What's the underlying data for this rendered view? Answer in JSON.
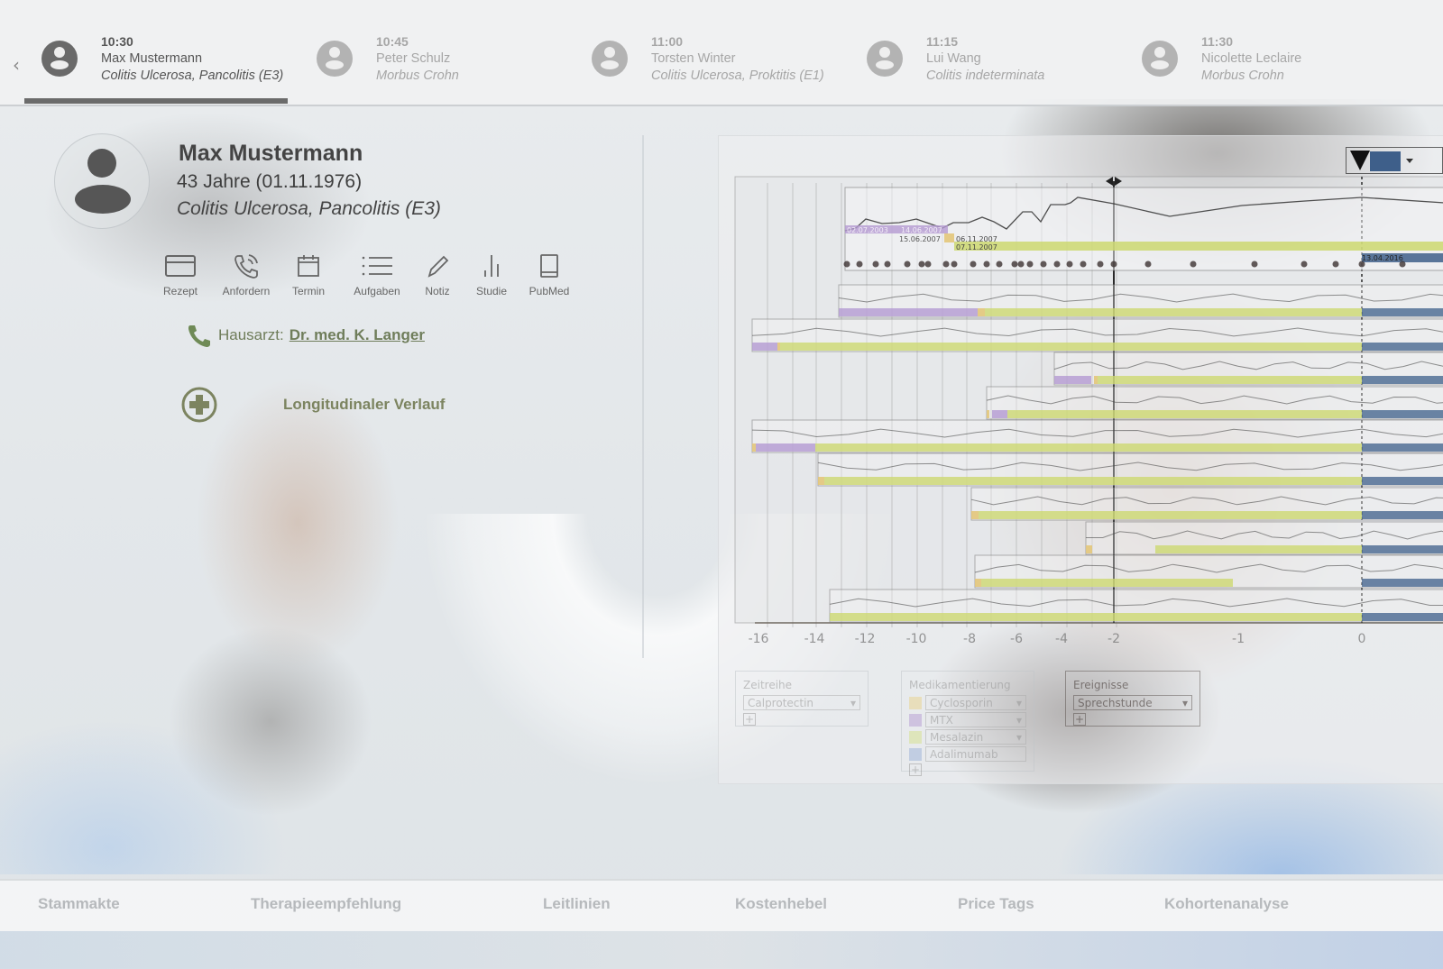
{
  "schedule": {
    "prev_icon": "chevron-left-icon",
    "appointments": [
      {
        "time": "10:30",
        "name": "Max Mustermann",
        "diagnosis": "Colitis Ulcerosa, Pancolitis (E3)",
        "active": true
      },
      {
        "time": "10:45",
        "name": "Peter Schulz",
        "diagnosis": "Morbus Crohn",
        "active": false
      },
      {
        "time": "11:00",
        "name": "Torsten Winter",
        "diagnosis": "Colitis Ulcerosa, Proktitis (E1)",
        "active": false
      },
      {
        "time": "11:15",
        "name": "Lui Wang",
        "diagnosis": "Colitis indeterminata",
        "active": false
      },
      {
        "time": "11:30",
        "name": "Nicolette Leclaire",
        "diagnosis": "Morbus Crohn",
        "active": false
      }
    ]
  },
  "patient": {
    "name": "Max Mustermann",
    "age": "43 Jahre (01.11.1976)",
    "diagnosis": "Colitis Ulcerosa, Pancolitis (E3)",
    "actions": [
      {
        "label": "Rezept",
        "icon": "credit-card-icon"
      },
      {
        "label": "Anfordern",
        "icon": "phone-ringing-icon"
      },
      {
        "label": "Termin",
        "icon": "calendar-icon"
      },
      {
        "label": "Aufgaben",
        "icon": "list-icon"
      },
      {
        "label": "Notiz",
        "icon": "pencil-icon"
      },
      {
        "label": "Studie",
        "icon": "bar-chart-icon"
      },
      {
        "label": "PubMed",
        "icon": "book-icon"
      }
    ],
    "gp_label": "Hausarzt:",
    "gp_name": "Dr. med. K. Langer",
    "longitudinal_label": "Longitudinaler Verlauf"
  },
  "chart": {
    "x_ticks": [
      "-16",
      "-14",
      "-12",
      "-10",
      "-8",
      "-6",
      "-4",
      "-2",
      "-1",
      "0"
    ],
    "date_labels": [
      "02.07.2003",
      "14.06.2007",
      "15.06.2007",
      "06.11.2007",
      "07.11.2007",
      "13.04.2016"
    ],
    "legend": {
      "timeseries": {
        "title": "Zeitreihe",
        "selected": "Calprotectin"
      },
      "medication": {
        "title": "Medikamentierung",
        "items": [
          {
            "label": "Cyclosporin",
            "color": "#e8d28a"
          },
          {
            "label": "MTX",
            "color": "#b49ad2"
          },
          {
            "label": "Mesalazin",
            "color": "#d4e08a"
          },
          {
            "label": "Adalimumab",
            "color": "#9ab0d8"
          }
        ]
      },
      "events": {
        "title": "Ereignisse",
        "selected": "Sprechstunde"
      }
    },
    "colors": {
      "mtx": "#b49ad2",
      "cyclosporin": "#e3c77a",
      "mesalazin": "#cdd870",
      "adalimumab": "#3e5f8a"
    }
  },
  "bottom_nav": {
    "items": [
      "Stammakte",
      "Therapieempfehlung",
      "Leitlinien",
      "Kostenhebel",
      "Price Tags",
      "Kohortenanalyse"
    ]
  }
}
